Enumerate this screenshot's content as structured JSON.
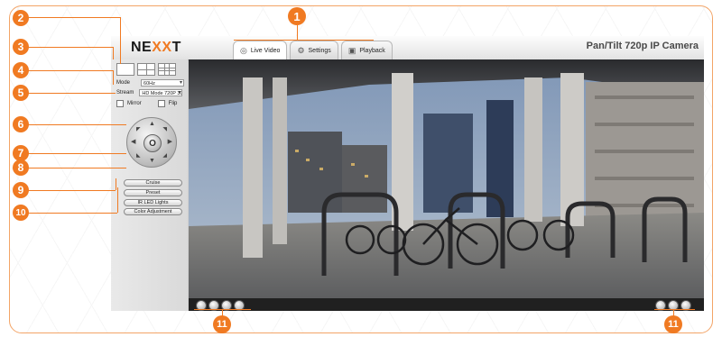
{
  "header": {
    "logo_pre": "NE",
    "logo_x": "XX",
    "logo_post": "T",
    "title": "Pan/Tilt 720p IP Camera",
    "tabs": [
      {
        "label": "Live Video",
        "icon": "camera-icon",
        "active": true
      },
      {
        "label": "Settings",
        "icon": "settings-icon",
        "active": false
      },
      {
        "label": "Playback",
        "icon": "playback-icon",
        "active": false
      }
    ]
  },
  "left_panel": {
    "mode_label": "Mode",
    "mode_value": "60Hz",
    "stream_label": "Stream",
    "stream_value": "HD Mode 720P 30",
    "mirror_label": "Mirror",
    "flip_label": "Flip",
    "ptz_center": "O",
    "buttons": {
      "cruise": "Cruise",
      "preset": "Preset",
      "ir_led": "IR LED Lights",
      "color": "Color Adjustment"
    }
  },
  "callouts": {
    "c1": "1",
    "c2": "2",
    "c3": "3",
    "c4": "4",
    "c5": "5",
    "c6": "6",
    "c7": "7",
    "c8": "8",
    "c9": "9",
    "c10": "10",
    "c11a": "11",
    "c11b": "11"
  },
  "colors": {
    "accent": "#f07a22",
    "frame": "#f3a467"
  }
}
